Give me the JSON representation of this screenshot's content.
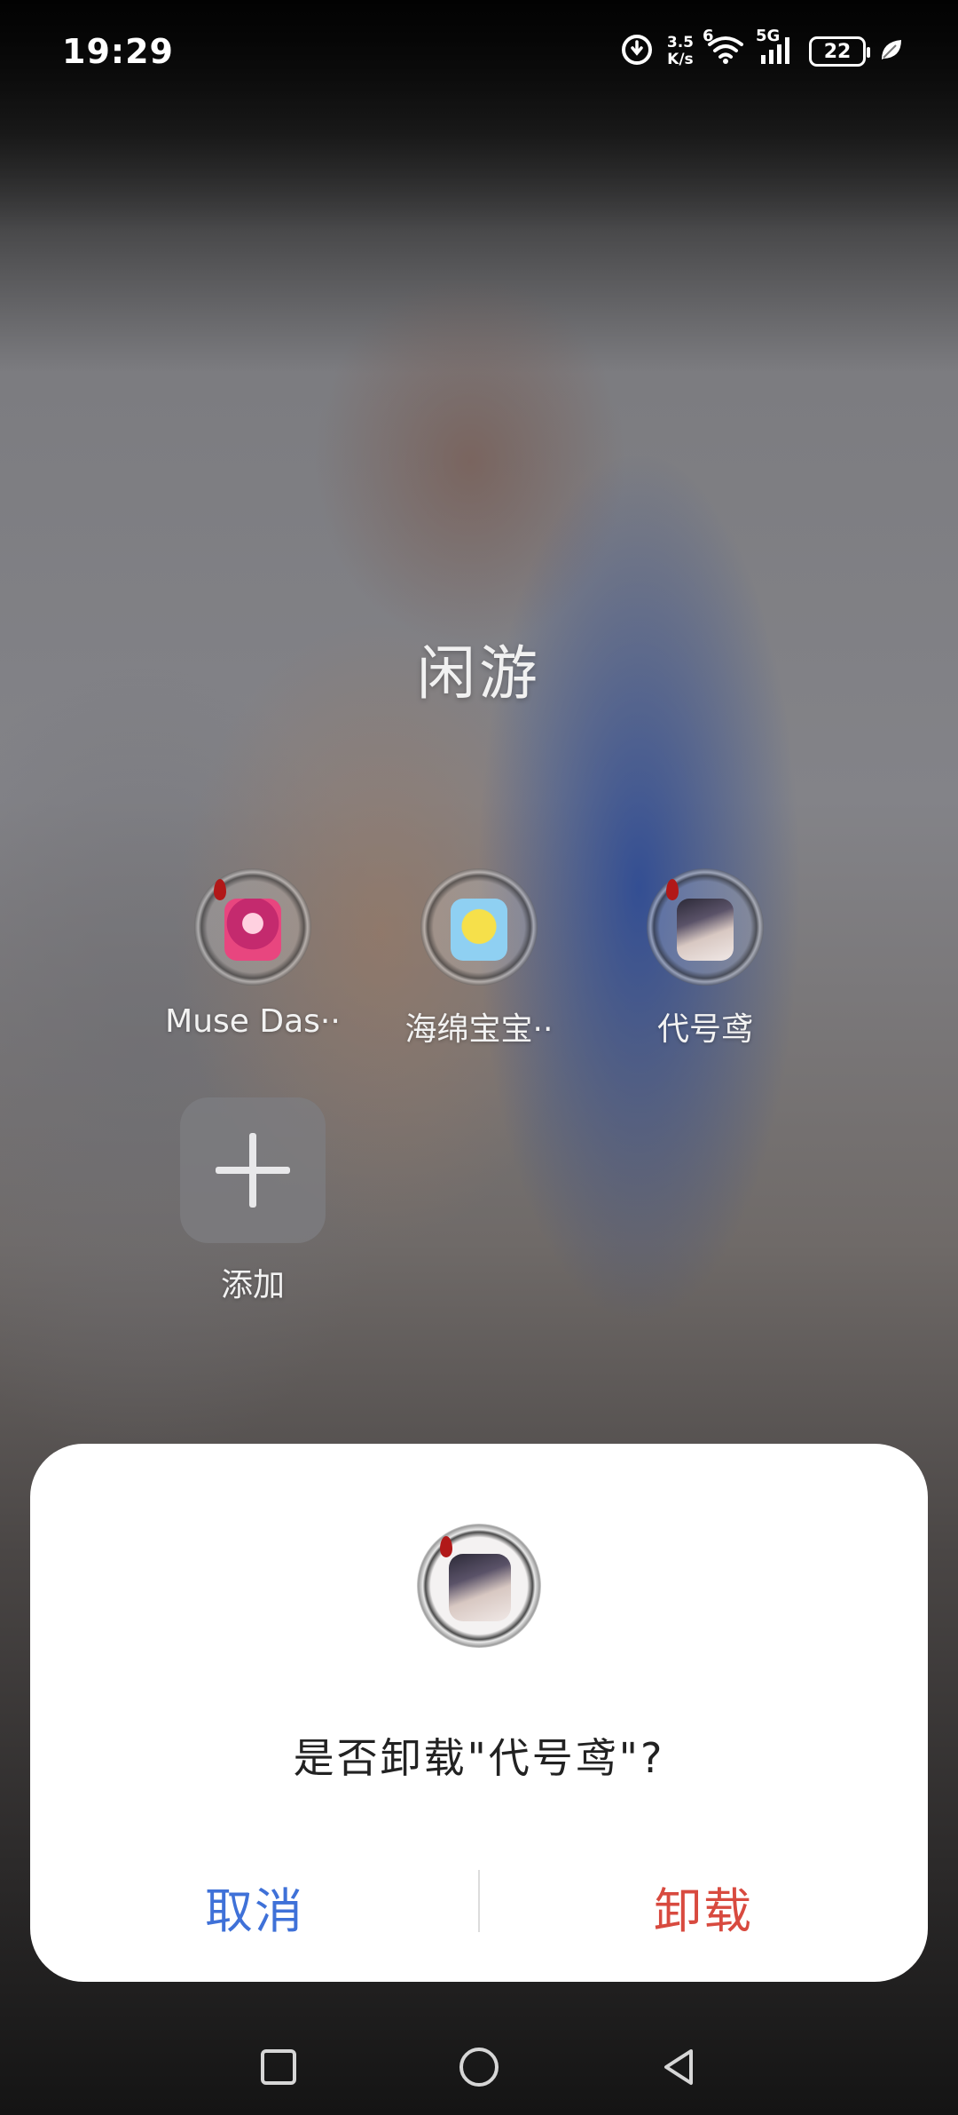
{
  "status_bar": {
    "time": "19:29",
    "net_speed_value": "3.5",
    "net_speed_unit": "K/s",
    "wifi_badge": "6",
    "network_type": "5G",
    "battery_level": "22",
    "icons": [
      "data-saver-icon",
      "wifi-icon",
      "signal-icon",
      "battery-icon",
      "leaf-icon"
    ]
  },
  "folder": {
    "title": "闲游",
    "apps": [
      {
        "label": "Muse Das··",
        "icon": "muse-dash-app-icon"
      },
      {
        "label": "海绵宝宝··",
        "icon": "spongebob-app-icon"
      },
      {
        "label": "代号鸢",
        "icon": "daihaoyuan-app-icon"
      }
    ],
    "add_label": "添加"
  },
  "dialog": {
    "message": "是否卸载\"代号鸢\"?",
    "cancel_label": "取消",
    "uninstall_label": "卸载",
    "colors": {
      "cancel": "#3f71d8",
      "uninstall": "#d84a3f"
    }
  },
  "nav_bar": {
    "buttons": [
      "recents-icon",
      "home-icon",
      "back-icon"
    ]
  }
}
